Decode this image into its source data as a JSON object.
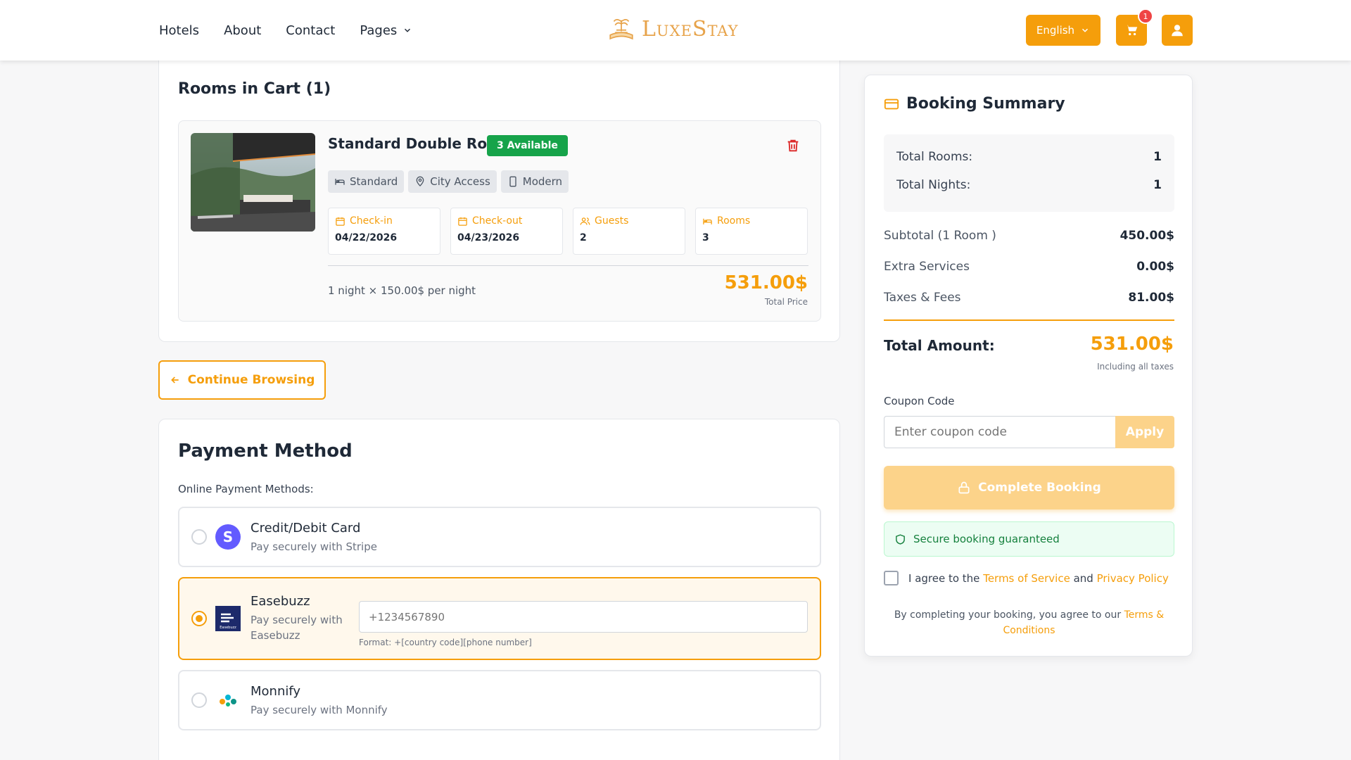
{
  "header": {
    "nav": [
      "Hotels",
      "About",
      "Contact",
      "Pages"
    ],
    "logo_text": "LuxeStay",
    "language": "English",
    "cart_count": "1",
    "accent_color": "#f59e0b"
  },
  "cart": {
    "title": "Rooms in Cart (1)",
    "room": {
      "name": "Standard Double Room",
      "availability": "3 Available",
      "tags": [
        "Standard",
        "City Access",
        "Modern"
      ],
      "details": [
        {
          "label": "Check-in",
          "value": "04/22/2026",
          "icon": "calendar-icon"
        },
        {
          "label": "Check-out",
          "value": "04/23/2026",
          "icon": "calendar-icon"
        },
        {
          "label": "Guests",
          "value": "2",
          "icon": "users-icon"
        },
        {
          "label": "Rooms",
          "value": "3",
          "icon": "bed-icon"
        }
      ],
      "night_text": "1 night × 150.00$ per night",
      "total_price": "531.00$",
      "total_price_label": "Total Price"
    },
    "continue_label": "Continue Browsing"
  },
  "payment": {
    "title": "Payment Method",
    "subtitle": "Online Payment Methods:",
    "options": [
      {
        "name": "Credit/Debit Card",
        "desc": "Pay securely with Stripe",
        "selected": false
      },
      {
        "name": "Easebuzz",
        "desc": "Pay securely with Easebuzz",
        "selected": true
      },
      {
        "name": "Monnify",
        "desc": "Pay securely with Monnify",
        "selected": false
      }
    ],
    "phone_placeholder": "+1234567890",
    "phone_hint": "Format: +[country code][phone number]"
  },
  "summary": {
    "title": "Booking Summary",
    "total_rooms_label": "Total Rooms:",
    "total_rooms": "1",
    "total_nights_label": "Total Nights:",
    "total_nights": "1",
    "subtotal_label": "Subtotal (1 Room )",
    "subtotal": "450.00$",
    "extra_label": "Extra Services",
    "extra": "0.00$",
    "taxes_label": "Taxes & Fees",
    "taxes": "81.00$",
    "total_label": "Total Amount:",
    "total": "531.00$",
    "total_sub": "Including all taxes",
    "coupon_label": "Coupon Code",
    "coupon_placeholder": "Enter coupon code",
    "apply_label": "Apply",
    "complete_label": "Complete Booking",
    "secure_text": "Secure booking guaranteed",
    "agree_prefix": "I agree to the",
    "terms_link": "Terms of Service",
    "agree_and": "and",
    "privacy_link": "Privacy Policy",
    "terms_note_prefix": "By completing your booking, you agree to our",
    "terms_note_link": "Terms & Conditions"
  }
}
